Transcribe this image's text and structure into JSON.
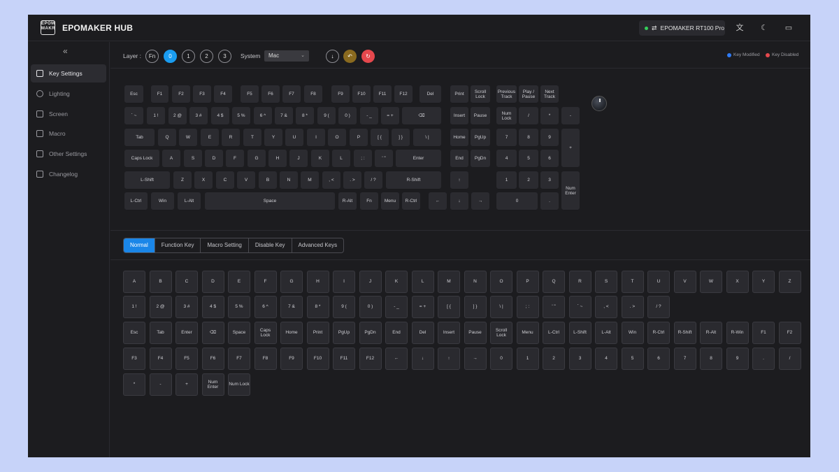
{
  "app": {
    "brand": "EPOMAKER HUB",
    "logo_text": "EPOM\nMAKER"
  },
  "device": {
    "name": "EPOMAKER RT100 Pro",
    "status_color": "#35d05a"
  },
  "topbar_icons": [
    "translate-icon",
    "moon-icon",
    "feedback-icon"
  ],
  "sidebar": {
    "collapse_label": "«",
    "items": [
      {
        "label": "Key Settings",
        "icon": "keyboard-icon",
        "active": true
      },
      {
        "label": "Lighting",
        "icon": "bulb-icon",
        "active": false
      },
      {
        "label": "Screen",
        "icon": "monitor-icon",
        "active": false
      },
      {
        "label": "Macro",
        "icon": "macro-icon",
        "active": false
      },
      {
        "label": "Other Settings",
        "icon": "grid-icon",
        "active": false
      },
      {
        "label": "Changelog",
        "icon": "document-icon",
        "active": false
      }
    ]
  },
  "layerbar": {
    "layer_label": "Layer :",
    "layers": [
      "Fn",
      "0",
      "1",
      "2",
      "3"
    ],
    "selected_layer": "0",
    "system_label": "System",
    "system_value": "Mac",
    "actions": [
      {
        "name": "download-icon",
        "glyph": "↓",
        "color": "transparent"
      },
      {
        "name": "undo-icon",
        "glyph": "↶",
        "color": "#8a6a1f"
      },
      {
        "name": "reset-icon",
        "glyph": "↻",
        "color": "#e5484d"
      }
    ],
    "legend": [
      {
        "label": "Key Modified",
        "color": "#2f7bf5"
      },
      {
        "label": "Key Disabled",
        "color": "#e5484d"
      }
    ]
  },
  "keyboard_rows": [
    [
      "Esc",
      "F1",
      "F2",
      "F3",
      "F4",
      "F5",
      "F6",
      "F7",
      "F8",
      "F9",
      "F10",
      "F11",
      "F12",
      "Del",
      "Print",
      "Scroll Lock",
      "Previous Track",
      "Play / Pause",
      "Next Track"
    ],
    [
      "` ~",
      "1 !",
      "2 @",
      "3 #",
      "4 $",
      "5 %",
      "6 ^",
      "7 &",
      "8 *",
      "9 (",
      "0 )",
      "- _",
      "= +",
      "⌫",
      "Insert",
      "Pause",
      "Num Lock",
      "/",
      "*",
      "-"
    ],
    [
      "Tab",
      "Q",
      "W",
      "E",
      "R",
      "T",
      "Y",
      "U",
      "I",
      "O",
      "P",
      "[ {",
      "] }",
      "\\ |",
      "Home",
      "PgUp",
      "7",
      "8",
      "9",
      "+"
    ],
    [
      "Caps Lock",
      "A",
      "S",
      "D",
      "F",
      "G",
      "H",
      "J",
      "K",
      "L",
      "; :",
      "' \"",
      "Enter",
      "End",
      "PgDn",
      "4",
      "5",
      "6"
    ],
    [
      "L-Shift",
      "Z",
      "X",
      "C",
      "V",
      "B",
      "N",
      "M",
      ", <",
      ". >",
      "/ ?",
      "R-Shift",
      "↑",
      "1",
      "2",
      "3",
      "Num Enter"
    ],
    [
      "L-Ctrl",
      "Win",
      "L-Alt",
      "Space",
      "R-Alt",
      "Fn",
      "Menu",
      "R-Ctrl",
      "←",
      "↓",
      "→",
      "0",
      "."
    ]
  ],
  "tabs": [
    {
      "label": "Normal",
      "selected": true
    },
    {
      "label": "Function Key",
      "selected": false
    },
    {
      "label": "Macro Setting",
      "selected": false
    },
    {
      "label": "Disable Key",
      "selected": false
    },
    {
      "label": "Advanced Keys",
      "selected": false
    }
  ],
  "picker_rows": [
    [
      "A",
      "B",
      "C",
      "D",
      "E",
      "F",
      "G",
      "H",
      "I",
      "J",
      "K",
      "L",
      "M",
      "N",
      "O",
      "P",
      "Q",
      "R",
      "S",
      "T",
      "U",
      "V",
      "W",
      "X",
      "Y",
      "Z"
    ],
    [
      "1 !",
      "2 @",
      "3 #",
      "4 $",
      "5 %",
      "6 ^",
      "7 &",
      "8 *",
      "9 (",
      "0 )",
      "- _",
      "= +",
      "[ {",
      "] }",
      "\\ |",
      "; :",
      "' \"",
      "` ~",
      ", <",
      ". >",
      "/ ?"
    ],
    [
      "Esc",
      "Tab",
      "Enter",
      "⌫",
      "Space",
      "Caps Lock",
      "Home",
      "Print",
      "PgUp",
      "PgDn",
      "End",
      "Del",
      "Insert",
      "Pause",
      "Scroll Lock",
      "Menu",
      "L-Ctrl",
      "L-Shift",
      "L-Alt",
      "Win",
      "R-Ctrl",
      "R-Shift",
      "R-Alt",
      "R-Win",
      "F1",
      "F2"
    ],
    [
      "F3",
      "F4",
      "F5",
      "F6",
      "F7",
      "F8",
      "F9",
      "F10",
      "F11",
      "F12",
      "←",
      "↓",
      "↑",
      "→",
      "0",
      "1",
      "2",
      "3",
      "4",
      "5",
      "6",
      "7",
      "8",
      "9",
      ".",
      "/"
    ],
    [
      "*",
      "-",
      "+",
      "Num Enter",
      "Num Lock"
    ]
  ]
}
